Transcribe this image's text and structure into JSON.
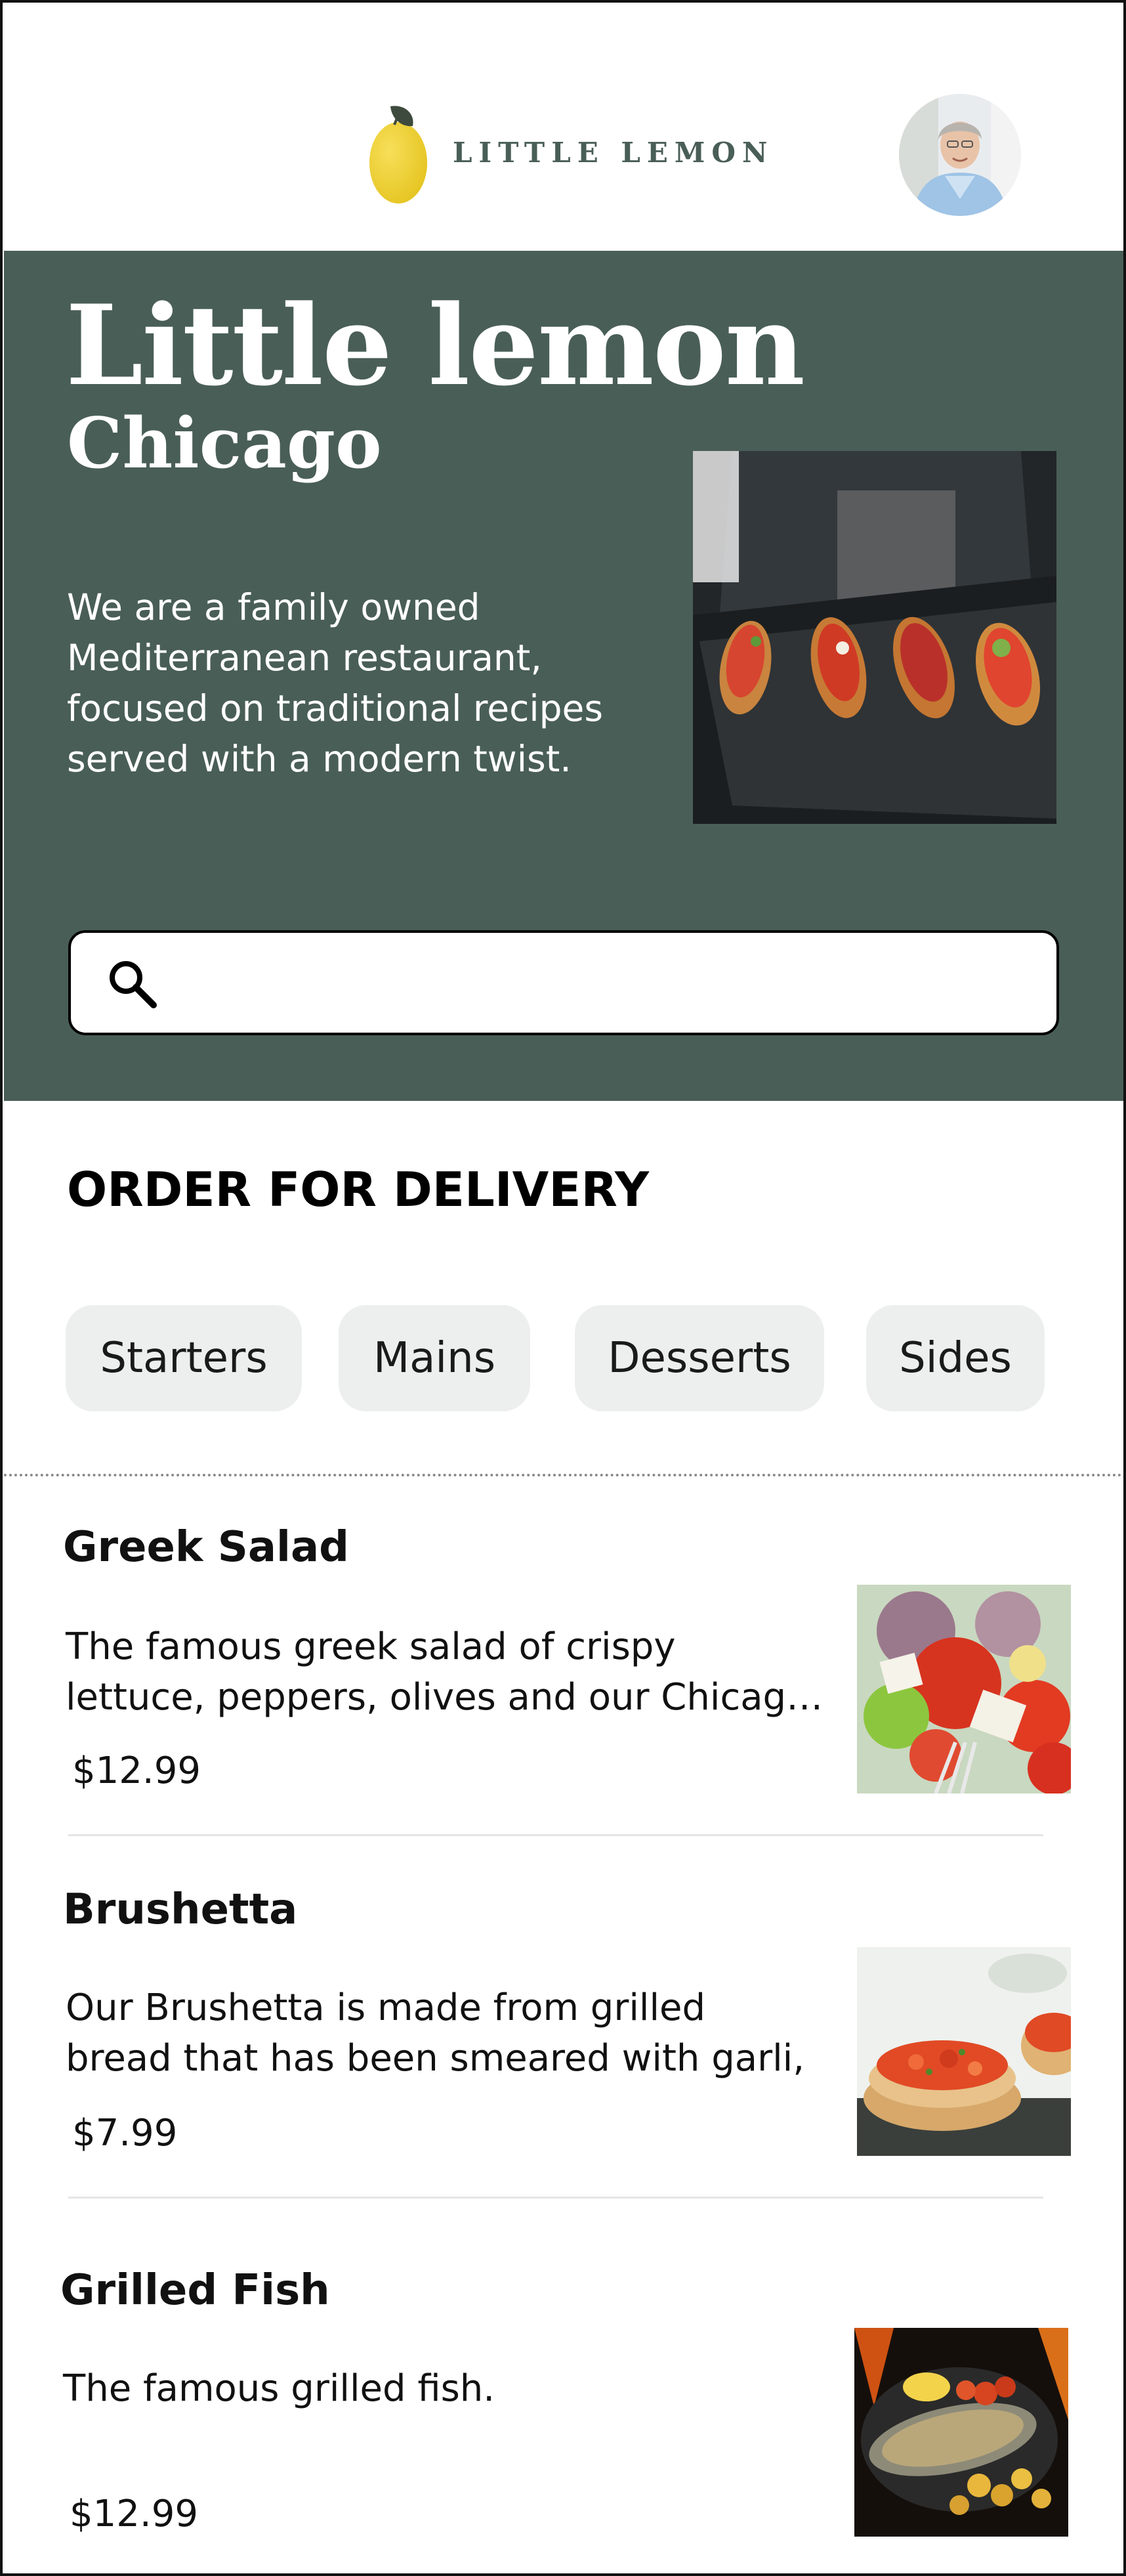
{
  "header": {
    "brand_name": "LITTLE LEMON",
    "logo_icon": "lemon-icon",
    "avatar_icon": "user-avatar"
  },
  "hero": {
    "title": "Little lemon",
    "subtitle": "Chicago",
    "description": "We are a family owned Mediterranean restaurant, focused on traditional recipes served with a modern twist.",
    "image": "bruschetta-platter-photo",
    "search": {
      "value": "",
      "placeholder": "",
      "icon": "search-icon"
    }
  },
  "order": {
    "title": "ORDER FOR DELIVERY",
    "categories": [
      {
        "label": "Starters"
      },
      {
        "label": "Mains"
      },
      {
        "label": "Desserts"
      },
      {
        "label": "Sides"
      }
    ]
  },
  "menu": {
    "items": [
      {
        "name": "Greek Salad",
        "description_line1": "The famous greek salad of crispy",
        "description_line2": "lettuce, peppers, olives and our Chicago style feta cheese",
        "price": "$12.99",
        "image": "greek-salad-photo"
      },
      {
        "name": "Brushetta",
        "description_line1": "Our Brushetta is made from grilled",
        "description_line2": "bread that has been smeared with garli,",
        "price": "$7.99",
        "image": "bruschetta-photo"
      },
      {
        "name": "Grilled Fish",
        "description_line1": "The famous grilled fish.",
        "description_line2": "",
        "price": "$12.99",
        "image": "grilled-fish-photo"
      }
    ]
  },
  "colors": {
    "primary_green": "#495E57",
    "pill_background": "#EDEFEE",
    "lemon_yellow": "#F4CE14"
  }
}
